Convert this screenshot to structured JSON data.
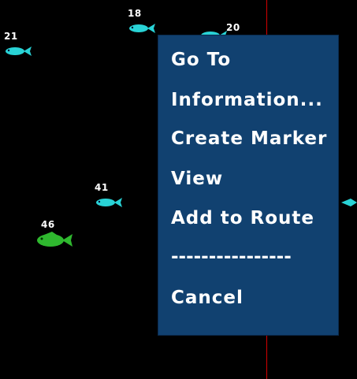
{
  "sonar": {
    "fish_targets": [
      {
        "depth_label": "21",
        "color": "#29d3d6"
      },
      {
        "depth_label": "18",
        "color": "#29d3d6"
      },
      {
        "depth_label": "20",
        "color": "#29d3d6"
      },
      {
        "depth_label": "41",
        "color": "#29d3d6"
      },
      {
        "depth_label": "46",
        "color": "#2fb82f"
      }
    ],
    "bottom_color": "#7a2a30",
    "cursor_line_color": "#d40000"
  },
  "context_menu": {
    "background": "#114170",
    "items": [
      {
        "label": "Go To"
      },
      {
        "label": "Information..."
      },
      {
        "label": "Create Marker"
      },
      {
        "label": "View"
      },
      {
        "label": "Add to Route"
      }
    ],
    "separator": "----------------",
    "cancel_label": "Cancel"
  }
}
